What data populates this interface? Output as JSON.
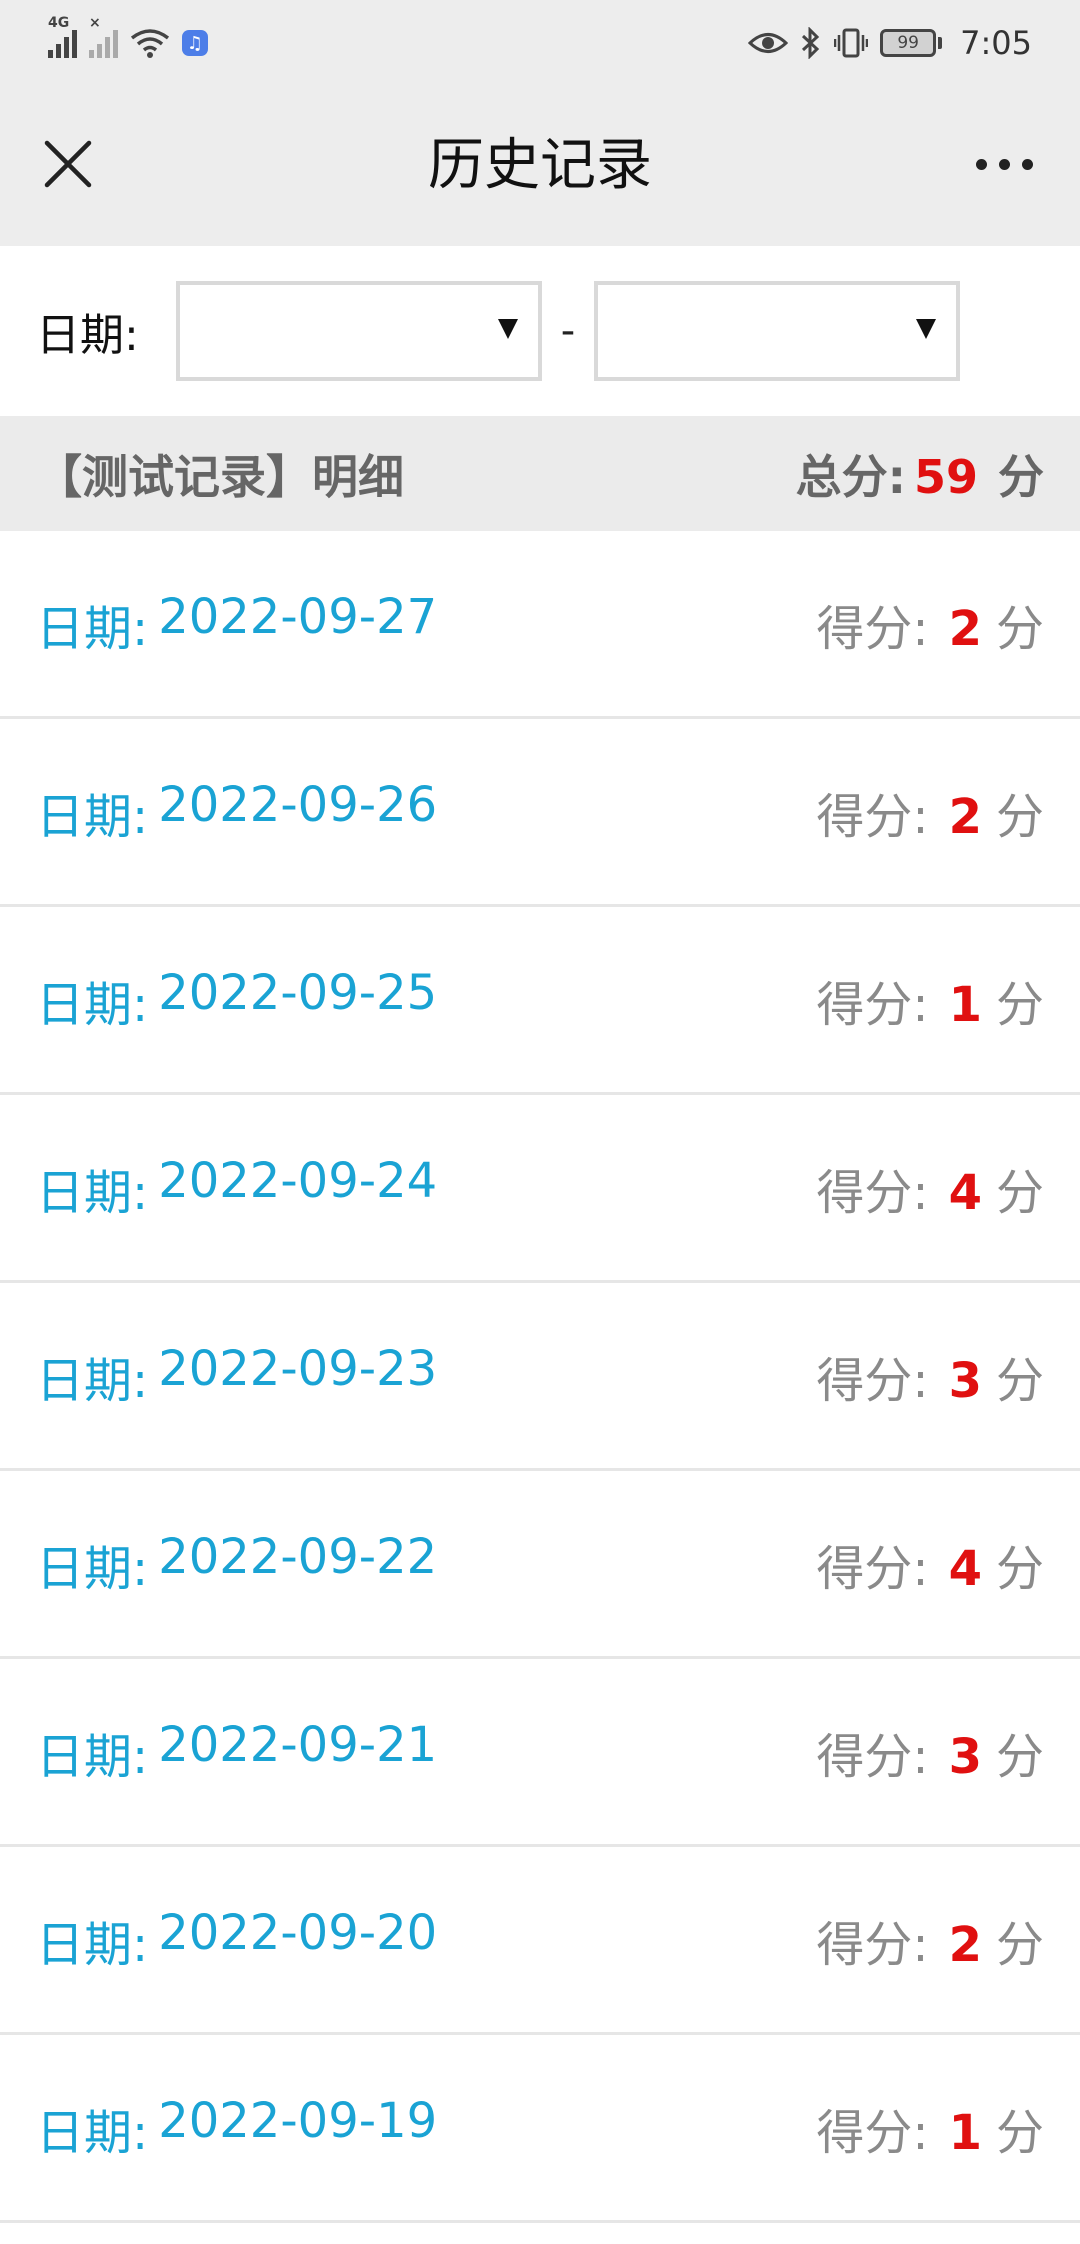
{
  "status_bar": {
    "network_label": "4G",
    "battery_level": "99",
    "time": "7:05",
    "icons": [
      "signal-4g-icon",
      "signal-no-sim-icon",
      "wifi-icon",
      "music-app-icon",
      "eye-comfort-icon",
      "bluetooth-icon",
      "vibrate-icon",
      "battery-icon"
    ]
  },
  "header": {
    "title": "历史记录",
    "close_icon": "close-icon",
    "more_icon": "more-icon"
  },
  "filter": {
    "date_label": "日期:",
    "start_date": "",
    "end_date": "",
    "separator": "-"
  },
  "summary": {
    "title": "【测试记录】明细",
    "total_label": "总分:",
    "total_value": "59",
    "unit": "分"
  },
  "records": [
    {
      "date_label": "日期:",
      "date": "2022-09-27",
      "score_label": "得分:",
      "score": "2",
      "unit": "分"
    },
    {
      "date_label": "日期:",
      "date": "2022-09-26",
      "score_label": "得分:",
      "score": "2",
      "unit": "分"
    },
    {
      "date_label": "日期:",
      "date": "2022-09-25",
      "score_label": "得分:",
      "score": "1",
      "unit": "分"
    },
    {
      "date_label": "日期:",
      "date": "2022-09-24",
      "score_label": "得分:",
      "score": "4",
      "unit": "分"
    },
    {
      "date_label": "日期:",
      "date": "2022-09-23",
      "score_label": "得分:",
      "score": "3",
      "unit": "分"
    },
    {
      "date_label": "日期:",
      "date": "2022-09-22",
      "score_label": "得分:",
      "score": "4",
      "unit": "分"
    },
    {
      "date_label": "日期:",
      "date": "2022-09-21",
      "score_label": "得分:",
      "score": "3",
      "unit": "分"
    },
    {
      "date_label": "日期:",
      "date": "2022-09-20",
      "score_label": "得分:",
      "score": "2",
      "unit": "分"
    },
    {
      "date_label": "日期:",
      "date": "2022-09-19",
      "score_label": "得分:",
      "score": "1",
      "unit": "分"
    }
  ],
  "colors": {
    "date_text": "#1aa3d4",
    "score_number": "#e01010",
    "header_bg": "#ededed",
    "summary_bg": "#ebebeb"
  }
}
